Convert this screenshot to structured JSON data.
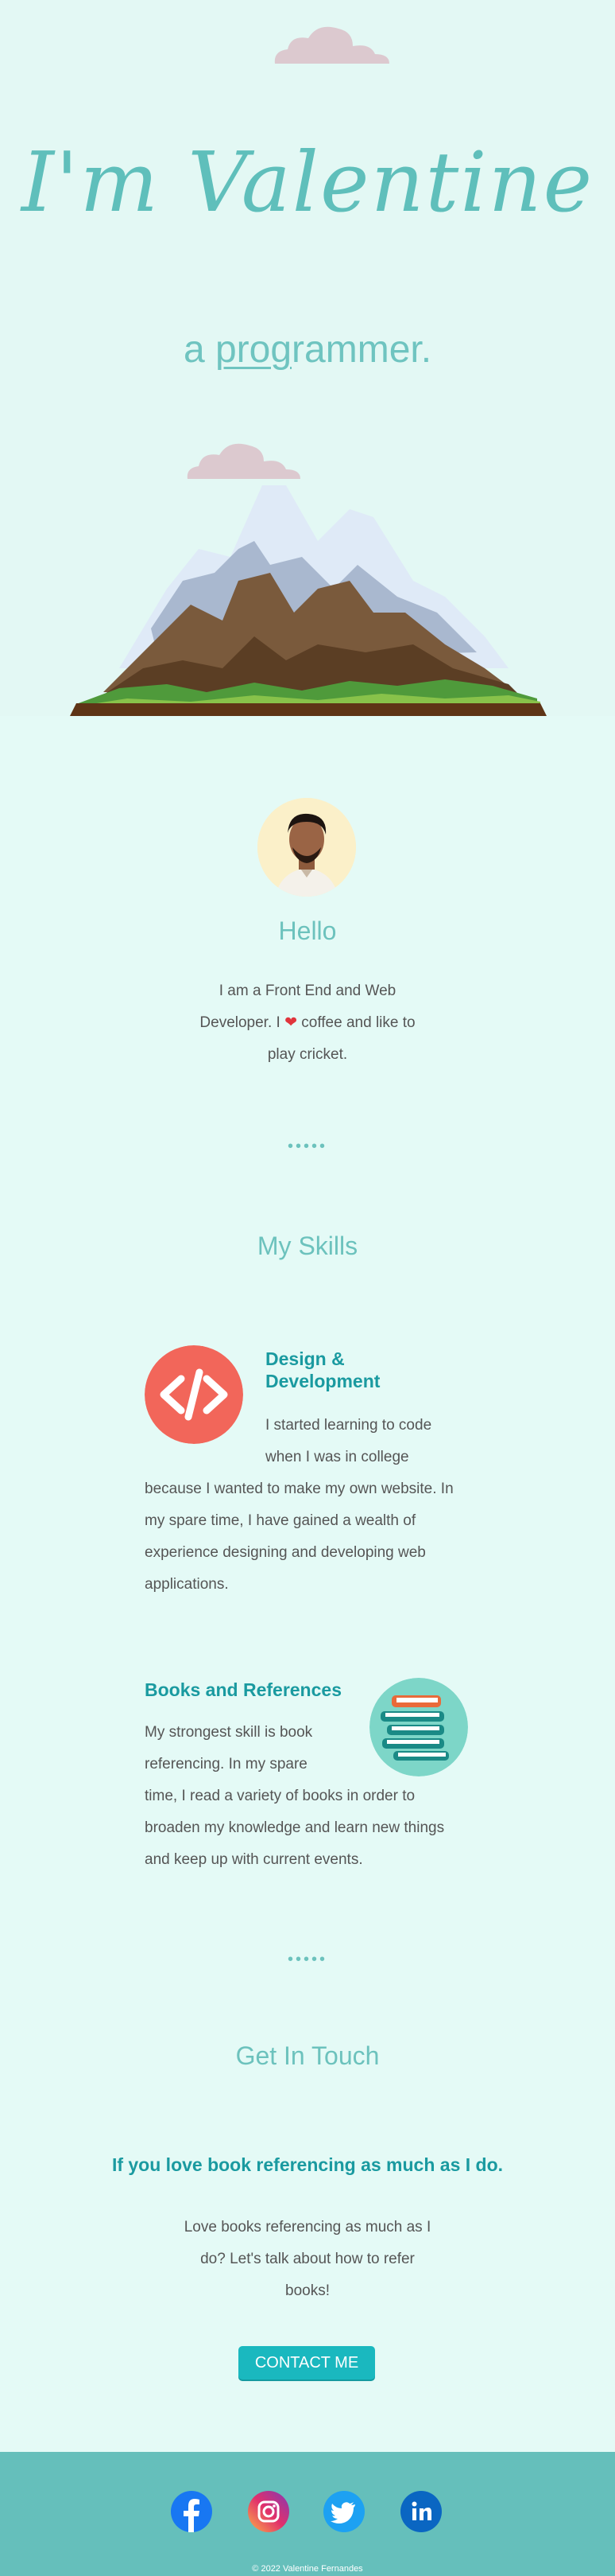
{
  "hero": {
    "title": "I'm Valentine",
    "subtitle_prefix": "a ",
    "subtitle_underlined": "prog",
    "subtitle_rest": "rammer."
  },
  "about": {
    "heading": "Hello",
    "text_before_heart": "I am a Front End and Web Developer. I ",
    "text_after_heart": " coffee and like to play cricket.",
    "heart_icon": "heart-icon"
  },
  "divider": "•••••",
  "skills": {
    "heading": "My Skills",
    "items": [
      {
        "title_line1": "Design &",
        "title_line2": "Development",
        "text": "I started learning to code when I was in college because I wanted to make my own website. In my spare time, I have gained a wealth of experience designing and developing web applications.",
        "icon": "code-icon",
        "icon_color": "#f2665a"
      },
      {
        "title": "Books and References",
        "text": "My strongest skill is book referencing. In my spare time, I read a variety of books in order to broaden my knowledge and learn new things and keep up with current events.",
        "icon": "books-icon",
        "icon_color": "#7dd6c8"
      }
    ]
  },
  "contact": {
    "heading": "Get In Touch",
    "title": "If you love book referencing as much as I do.",
    "text": "Love books referencing as much as I do? Let's talk about how to refer books!",
    "button": "CONTACT ME"
  },
  "footer": {
    "social": [
      "facebook-icon",
      "instagram-icon",
      "twitter-icon",
      "linkedin-icon"
    ],
    "copyright": "© 2022 Valentine Fernandes"
  },
  "colors": {
    "accent": "#6cc2bd",
    "title_teal": "#1a9aa0",
    "footer_bg": "#65bfbb",
    "page_bg": "#e4faf6"
  }
}
